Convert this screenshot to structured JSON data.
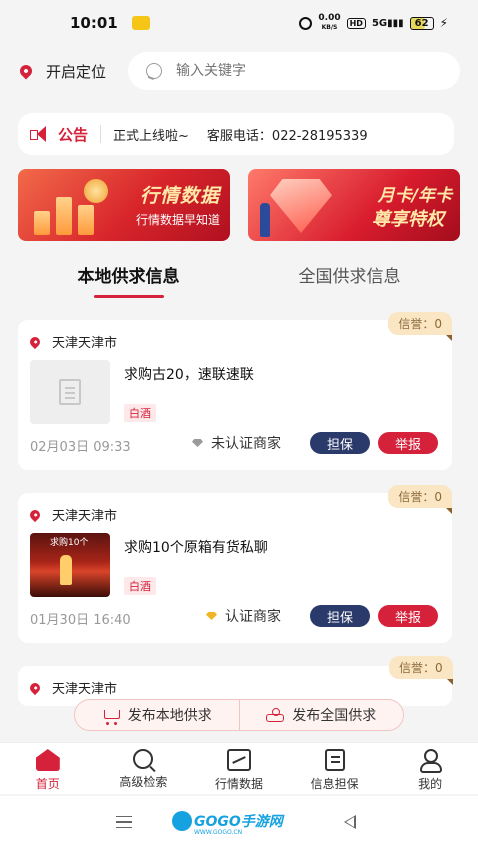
{
  "status_bar": {
    "time": "10:01",
    "speed": "0.00",
    "speed_unit": "KB/S",
    "hd": "HD",
    "signal": "5G",
    "battery": "62"
  },
  "header": {
    "location_label": "开启定位",
    "search_placeholder": "输入关键字"
  },
  "notice": {
    "label": "公告",
    "text": "正式上线啦~",
    "phone": "客服电话：022-28195339"
  },
  "banners": [
    {
      "title": "行情数据",
      "subtitle": "行情数据早知道"
    },
    {
      "title": "月卡/年卡",
      "subtitle": "尊享特权"
    }
  ],
  "tabs": [
    {
      "label": "本地供求信息",
      "active": true
    },
    {
      "label": "全国供求信息",
      "active": false
    }
  ],
  "posts": [
    {
      "credit": "信誉：0",
      "city": "天津天津市",
      "title": "求购古20，速联速联",
      "tag": "白酒",
      "date": "02月03日 09:33",
      "verify": "未认证商家",
      "guarantee": "担保",
      "report": "举报"
    },
    {
      "credit": "信誉：0",
      "city": "天津天津市",
      "photo_caption": "求购10个",
      "title": "求购10个原箱有货私聊",
      "tag": "白酒",
      "date": "01月30日 16:40",
      "verify": "认证商家",
      "guarantee": "担保",
      "report": "举报"
    },
    {
      "credit": "信誉：0",
      "city": "天津天津市"
    }
  ],
  "publish": {
    "local": "发布本地供求",
    "national": "发布全国供求"
  },
  "bottom_nav": [
    {
      "label": "首页",
      "icon": "home-icon"
    },
    {
      "label": "高级检索",
      "icon": "search-icon"
    },
    {
      "label": "行情数据",
      "icon": "chart-icon"
    },
    {
      "label": "信息担保",
      "icon": "document-icon"
    },
    {
      "label": "我的",
      "icon": "user-icon"
    }
  ],
  "watermark": {
    "text": "GOGO手游网",
    "sub": "WWW.GOGO.CN"
  },
  "colors": {
    "accent": "#d6213a",
    "navy": "#2a3a6a",
    "credit_bg": "#fbe6c4"
  }
}
